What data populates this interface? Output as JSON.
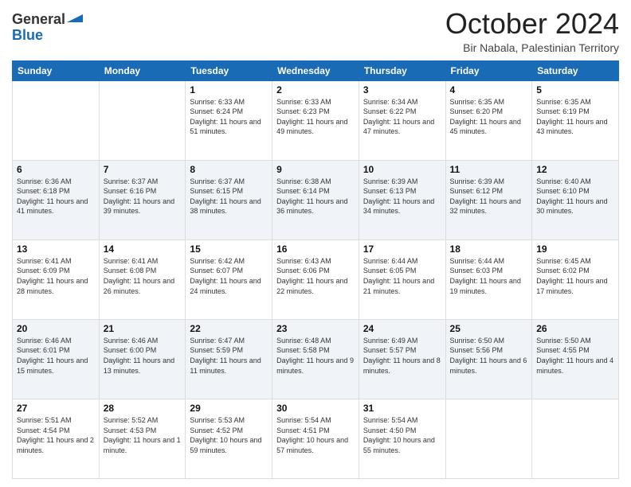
{
  "logo": {
    "line1": "General",
    "line2": "Blue"
  },
  "header": {
    "month": "October 2024",
    "location": "Bir Nabala, Palestinian Territory"
  },
  "weekdays": [
    "Sunday",
    "Monday",
    "Tuesday",
    "Wednesday",
    "Thursday",
    "Friday",
    "Saturday"
  ],
  "weeks": [
    [
      null,
      null,
      {
        "day": 1,
        "sunrise": "6:33 AM",
        "sunset": "6:24 PM",
        "daylight": "11 hours and 51 minutes."
      },
      {
        "day": 2,
        "sunrise": "6:33 AM",
        "sunset": "6:23 PM",
        "daylight": "11 hours and 49 minutes."
      },
      {
        "day": 3,
        "sunrise": "6:34 AM",
        "sunset": "6:22 PM",
        "daylight": "11 hours and 47 minutes."
      },
      {
        "day": 4,
        "sunrise": "6:35 AM",
        "sunset": "6:20 PM",
        "daylight": "11 hours and 45 minutes."
      },
      {
        "day": 5,
        "sunrise": "6:35 AM",
        "sunset": "6:19 PM",
        "daylight": "11 hours and 43 minutes."
      }
    ],
    [
      {
        "day": 6,
        "sunrise": "6:36 AM",
        "sunset": "6:18 PM",
        "daylight": "11 hours and 41 minutes."
      },
      {
        "day": 7,
        "sunrise": "6:37 AM",
        "sunset": "6:16 PM",
        "daylight": "11 hours and 39 minutes."
      },
      {
        "day": 8,
        "sunrise": "6:37 AM",
        "sunset": "6:15 PM",
        "daylight": "11 hours and 38 minutes."
      },
      {
        "day": 9,
        "sunrise": "6:38 AM",
        "sunset": "6:14 PM",
        "daylight": "11 hours and 36 minutes."
      },
      {
        "day": 10,
        "sunrise": "6:39 AM",
        "sunset": "6:13 PM",
        "daylight": "11 hours and 34 minutes."
      },
      {
        "day": 11,
        "sunrise": "6:39 AM",
        "sunset": "6:12 PM",
        "daylight": "11 hours and 32 minutes."
      },
      {
        "day": 12,
        "sunrise": "6:40 AM",
        "sunset": "6:10 PM",
        "daylight": "11 hours and 30 minutes."
      }
    ],
    [
      {
        "day": 13,
        "sunrise": "6:41 AM",
        "sunset": "6:09 PM",
        "daylight": "11 hours and 28 minutes."
      },
      {
        "day": 14,
        "sunrise": "6:41 AM",
        "sunset": "6:08 PM",
        "daylight": "11 hours and 26 minutes."
      },
      {
        "day": 15,
        "sunrise": "6:42 AM",
        "sunset": "6:07 PM",
        "daylight": "11 hours and 24 minutes."
      },
      {
        "day": 16,
        "sunrise": "6:43 AM",
        "sunset": "6:06 PM",
        "daylight": "11 hours and 22 minutes."
      },
      {
        "day": 17,
        "sunrise": "6:44 AM",
        "sunset": "6:05 PM",
        "daylight": "11 hours and 21 minutes."
      },
      {
        "day": 18,
        "sunrise": "6:44 AM",
        "sunset": "6:03 PM",
        "daylight": "11 hours and 19 minutes."
      },
      {
        "day": 19,
        "sunrise": "6:45 AM",
        "sunset": "6:02 PM",
        "daylight": "11 hours and 17 minutes."
      }
    ],
    [
      {
        "day": 20,
        "sunrise": "6:46 AM",
        "sunset": "6:01 PM",
        "daylight": "11 hours and 15 minutes."
      },
      {
        "day": 21,
        "sunrise": "6:46 AM",
        "sunset": "6:00 PM",
        "daylight": "11 hours and 13 minutes."
      },
      {
        "day": 22,
        "sunrise": "6:47 AM",
        "sunset": "5:59 PM",
        "daylight": "11 hours and 11 minutes."
      },
      {
        "day": 23,
        "sunrise": "6:48 AM",
        "sunset": "5:58 PM",
        "daylight": "11 hours and 9 minutes."
      },
      {
        "day": 24,
        "sunrise": "6:49 AM",
        "sunset": "5:57 PM",
        "daylight": "11 hours and 8 minutes."
      },
      {
        "day": 25,
        "sunrise": "6:50 AM",
        "sunset": "5:56 PM",
        "daylight": "11 hours and 6 minutes."
      },
      {
        "day": 26,
        "sunrise": "5:50 AM",
        "sunset": "4:55 PM",
        "daylight": "11 hours and 4 minutes."
      }
    ],
    [
      {
        "day": 27,
        "sunrise": "5:51 AM",
        "sunset": "4:54 PM",
        "daylight": "11 hours and 2 minutes."
      },
      {
        "day": 28,
        "sunrise": "5:52 AM",
        "sunset": "4:53 PM",
        "daylight": "11 hours and 1 minute."
      },
      {
        "day": 29,
        "sunrise": "5:53 AM",
        "sunset": "4:52 PM",
        "daylight": "10 hours and 59 minutes."
      },
      {
        "day": 30,
        "sunrise": "5:54 AM",
        "sunset": "4:51 PM",
        "daylight": "10 hours and 57 minutes."
      },
      {
        "day": 31,
        "sunrise": "5:54 AM",
        "sunset": "4:50 PM",
        "daylight": "10 hours and 55 minutes."
      },
      null,
      null
    ]
  ],
  "labels": {
    "sunrise_prefix": "Sunrise: ",
    "sunset_prefix": "Sunset: ",
    "daylight_prefix": "Daylight: "
  }
}
